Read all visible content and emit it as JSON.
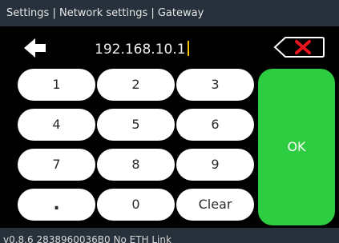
{
  "title_bar": {
    "breadcrumb": "Settings | Network settings | Gateway"
  },
  "input": {
    "value": "192.168.10.1"
  },
  "keypad": {
    "keys": [
      "1",
      "2",
      "3",
      "4",
      "5",
      "6",
      "7",
      "8",
      "9",
      ".",
      "0",
      "Clear"
    ],
    "ok_label": "OK"
  },
  "status_bar": {
    "text": "v0.8.6  2838960036B0  No ETH Link"
  },
  "icons": {
    "back": "arrow-left-icon",
    "backspace": "backspace-icon"
  },
  "colors": {
    "title_bar": "#26313b",
    "ok_green": "#2ecc40",
    "backspace_x_red": "#e8141e",
    "caret_yellow": "#f5c400"
  }
}
